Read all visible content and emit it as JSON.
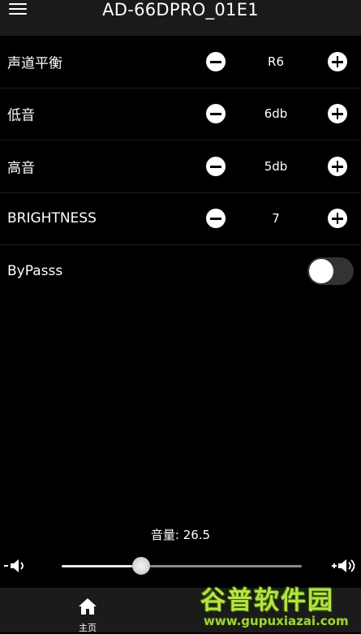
{
  "header": {
    "title": "AD-66DPRO_01E1",
    "menu_icon": "hamburger-menu-icon"
  },
  "settings": [
    {
      "label": "声道平衡",
      "value": "R6"
    },
    {
      "label": "低音",
      "value": "6db"
    },
    {
      "label": "高音",
      "value": "5db"
    },
    {
      "label": "BRIGHTNESS",
      "value": "7"
    }
  ],
  "bypass": {
    "label": "ByPasss",
    "enabled": false
  },
  "volume": {
    "label": "音量: 26.5",
    "level": 26.5,
    "slider_fraction": 0.33,
    "decrease_icon": "volume-down-icon",
    "increase_icon": "volume-up-icon"
  },
  "nav": {
    "home_label": "主页",
    "home_icon": "home-icon"
  },
  "watermark": {
    "brand": "谷普软件园",
    "url": "www.gupuxiazai.com"
  },
  "colors": {
    "background": "#000000",
    "header_bg": "#1a1a1a",
    "nav_bg": "#1b1b1b",
    "toggle_off": "#333333",
    "watermark_green": "#b8e04a"
  }
}
